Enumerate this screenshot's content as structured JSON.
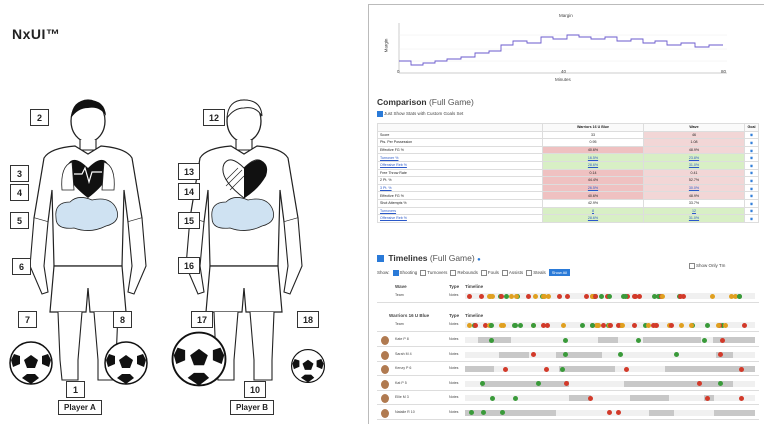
{
  "brand": "NxUI™",
  "player_a": {
    "label": "Player A",
    "numbers": {
      "n1": "1",
      "n2": "2",
      "n3": "3",
      "n4": "4",
      "n5": "5",
      "n6": "6",
      "n7": "7",
      "n8": "8"
    }
  },
  "player_b": {
    "label": "Player B",
    "numbers": {
      "n10": "10",
      "n12": "12",
      "n13": "13",
      "n14": "14",
      "n15": "15",
      "n16": "16",
      "n17": "17",
      "n18": "18"
    }
  },
  "margin_chart": {
    "title": "Margin",
    "ylabel": "Margin",
    "xlabel": "Minutes",
    "x_ticks": [
      "0",
      "40",
      "80"
    ]
  },
  "comparison": {
    "title": "Comparison",
    "subtitle": "(Full Game)",
    "checkbox_label": "Just Show Stats with Custom Goals Set",
    "headers": {
      "stat": "",
      "team_a": "Warriors 16 U Blue",
      "team_b": "Wave",
      "goal": "Goal"
    },
    "rows": [
      {
        "stat": "Score",
        "a": "33",
        "b": "46",
        "ca": "",
        "cb": "rl"
      },
      {
        "stat": "Pts. Per Possession",
        "a": "0.95",
        "b": "1.08",
        "ca": "",
        "cb": "rl"
      },
      {
        "stat": "Effective FG %",
        "a": "40.6%",
        "b": "48.9%",
        "ca": "r",
        "cb": "rl"
      },
      {
        "stat": "Turnover %",
        "a": "16.5%",
        "b": "23.8%",
        "ca": "g",
        "cb": "g"
      },
      {
        "stat": "Offensive Reb %",
        "a": "28.6%",
        "b": "31.0%",
        "ca": "g",
        "cb": "g"
      },
      {
        "stat": "Free Throw Rate",
        "a": "0.14",
        "b": "0.41",
        "ca": "r",
        "cb": "rl"
      },
      {
        "stat": "2 Pt. %",
        "a": "44.4%",
        "b": "52.7%",
        "ca": "r",
        "cb": "rl"
      },
      {
        "stat": "3 Pt. %",
        "a": "26.5%",
        "b": "30.0%",
        "ca": "r",
        "cb": "rl"
      },
      {
        "stat": "Effective FG %",
        "a": "40.6%",
        "b": "48.9%",
        "ca": "r",
        "cb": "rl"
      },
      {
        "stat": "Shot Attempts %",
        "a": "42.9%",
        "b": "33.7%",
        "ca": "",
        "cb": ""
      },
      {
        "stat": "Turnovers",
        "a": "8",
        "b": "12",
        "ca": "g",
        "cb": "g"
      },
      {
        "stat": "Offensive Reb %",
        "a": "28.6%",
        "b": "31.0%",
        "ca": "g",
        "cb": "g"
      }
    ]
  },
  "timelines": {
    "title": "Timelines",
    "subtitle": "(Full Game)",
    "show_label": "Show:",
    "filters": [
      "Shooting",
      "Turnovers",
      "Rebounds",
      "Fouls",
      "Assists",
      "Steals"
    ],
    "show_all": "Show All",
    "show_only_toggle": "Show Only Tm",
    "team_b_header": "Wave",
    "team_a_header": "Warriors 16 U Blue",
    "col_type": "Type",
    "col_timeline": "Timeline",
    "team_label": "Team",
    "row_type": "Notes",
    "players": [
      "Kate P 8",
      "Sarah M 4",
      "Kenzy P 6",
      "Kat P 5",
      "Ellie M 3",
      "Natalie R 10"
    ],
    "colors": {
      "make": "#3a9a3a",
      "miss": "#d23a2a",
      "turnover": "#e0a020"
    }
  }
}
